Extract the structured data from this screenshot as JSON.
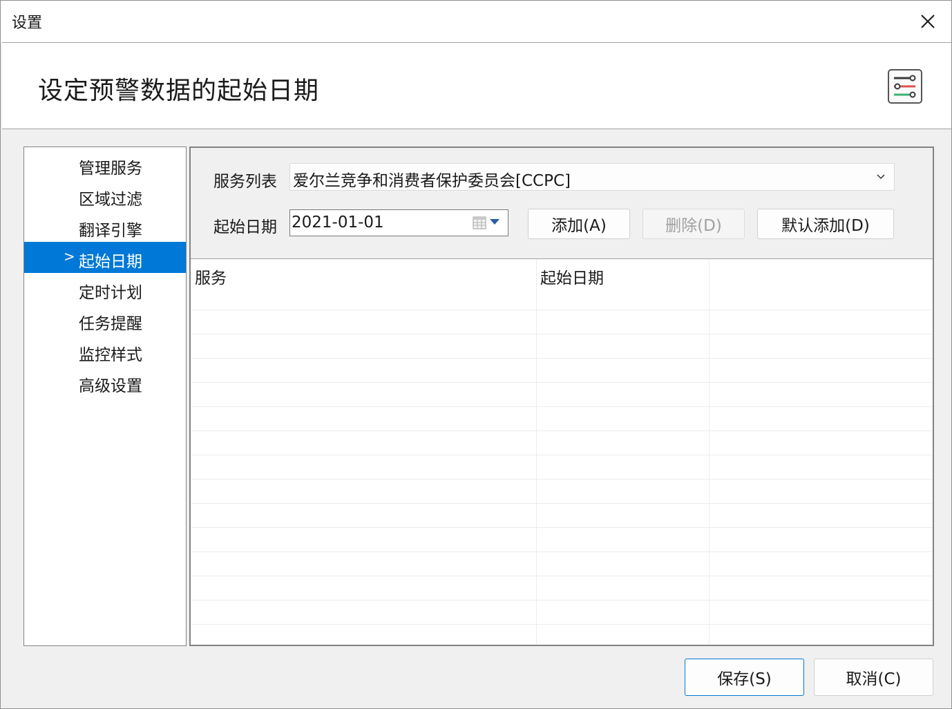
{
  "window": {
    "title": "设置"
  },
  "header": {
    "heading": "设定预警数据的起始日期",
    "icon": "settings-sliders-icon"
  },
  "sidebar": {
    "items": [
      {
        "label": "管理服务",
        "selected": false
      },
      {
        "label": "区域过滤",
        "selected": false
      },
      {
        "label": "翻译引擎",
        "selected": false
      },
      {
        "label": "起始日期",
        "selected": true,
        "marker": ">"
      },
      {
        "label": "定时计划",
        "selected": false
      },
      {
        "label": "任务提醒",
        "selected": false
      },
      {
        "label": "监控样式",
        "selected": false
      },
      {
        "label": "高级设置",
        "selected": false
      }
    ]
  },
  "form": {
    "service_label": "服务列表",
    "service_value": "爱尔兰竞争和消费者保护委员会[CCPC]",
    "date_label": "起始日期",
    "date_value": "2021-01-01",
    "add_button": "添加(A)",
    "delete_button": "删除(D)",
    "default_add_button": "默认添加(D)"
  },
  "grid": {
    "columns": [
      "服务",
      "起始日期",
      ""
    ],
    "rows": []
  },
  "footer": {
    "save_button": "保存(S)",
    "cancel_button": "取消(C)"
  },
  "colors": {
    "accent": "#0078d7",
    "window_bg": "#f0f0f0"
  }
}
